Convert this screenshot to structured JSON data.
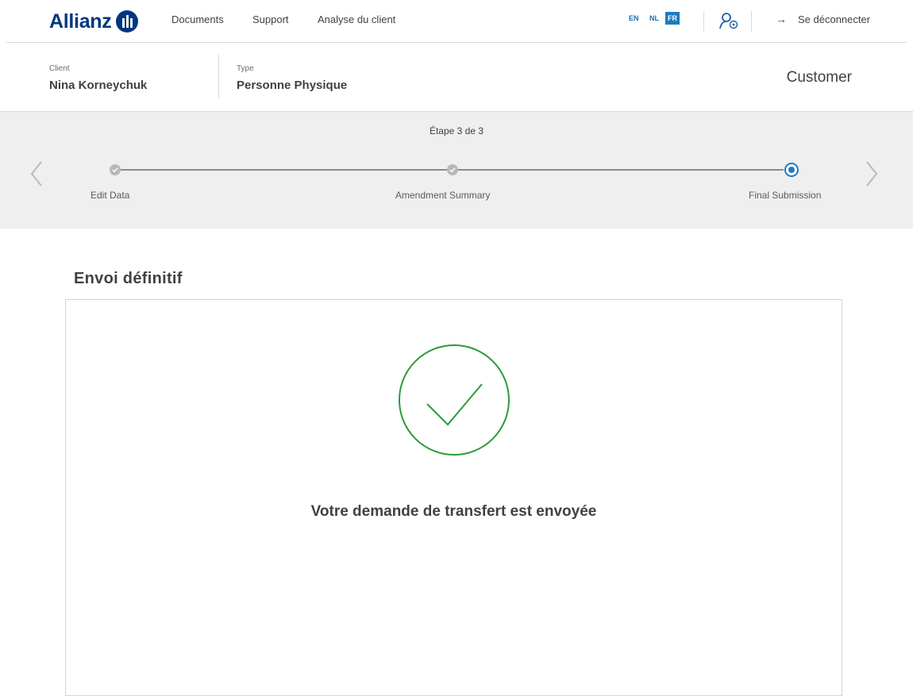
{
  "brand": {
    "name": "Allianz",
    "color": "#003781"
  },
  "nav": {
    "links": [
      "Documents",
      "Support",
      "Analyse du client"
    ],
    "languages": [
      "EN",
      "NL",
      "FR"
    ],
    "active_language": "FR",
    "user_icon": "user-settings-icon",
    "logout_label": "Se déconnecter",
    "logout_icon": "arrow-right-icon"
  },
  "client_bar": {
    "client_label": "Client",
    "client_value": "Nina Korneychuk",
    "type_label": "Type",
    "type_value": "Personne Physique",
    "role": "Customer"
  },
  "stepper": {
    "counter": "Étape 3 de 3",
    "steps": [
      {
        "label": "Edit Data",
        "status": "done"
      },
      {
        "label": "Amendment Summary",
        "status": "done"
      },
      {
        "label": "Final Submission",
        "status": "current"
      }
    ],
    "prev_icon": "chevron-left-icon",
    "next_icon": "chevron-right-icon",
    "accent_color": "#1d7bc1"
  },
  "main": {
    "section_title": "Envoi définitif",
    "success_icon": "check-circle-icon",
    "success_color": "#2f9a3a",
    "success_message": "Votre demande de transfert est envoyée"
  }
}
